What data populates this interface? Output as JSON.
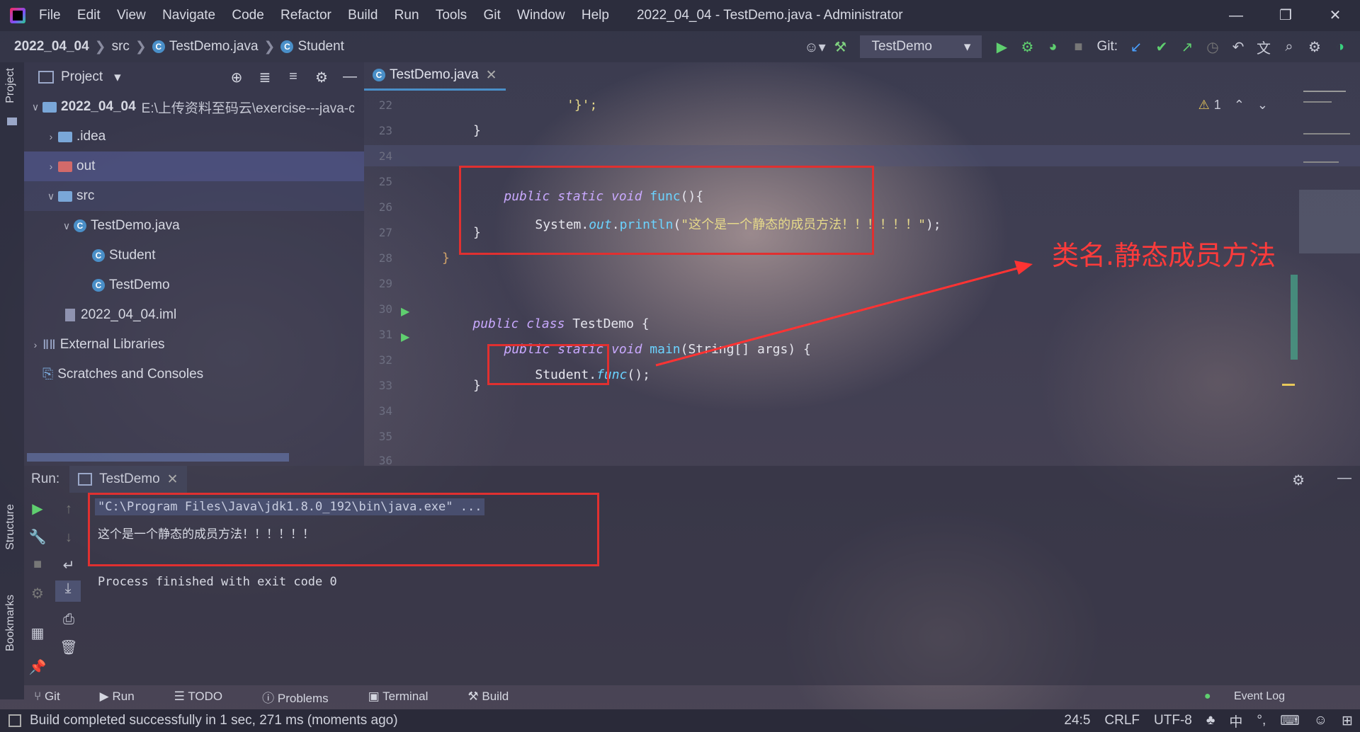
{
  "window": {
    "menu": [
      "File",
      "Edit",
      "View",
      "Navigate",
      "Code",
      "Refactor",
      "Build",
      "Run",
      "Tools",
      "Git",
      "Window",
      "Help"
    ],
    "title": "2022_04_04 - TestDemo.java - Administrator"
  },
  "breadcrumb": {
    "project": "2022_04_04",
    "folder": "src",
    "file": "TestDemo.java",
    "class": "Student"
  },
  "toolbar": {
    "run_config": "TestDemo",
    "git_label": "Git:"
  },
  "project_panel": {
    "title": "Project",
    "root": "2022_04_04",
    "root_path": "E:\\上传资料至码云\\exercise---java-cc",
    "items": {
      "idea": ".idea",
      "out": "out",
      "src": "src",
      "testdemo_java": "TestDemo.java",
      "student": "Student",
      "testdemo": "TestDemo",
      "iml": "2022_04_04.iml",
      "libs": "External Libraries",
      "scratches": "Scratches and Consoles"
    }
  },
  "editor": {
    "tab": "TestDemo.java",
    "warning_count": "1",
    "line_numbers": [
      "22",
      "23",
      "24",
      "25",
      "26",
      "27",
      "28",
      "29",
      "30",
      "31",
      "32",
      "33",
      "34",
      "35",
      "36"
    ],
    "code": {
      "l22": "'}';",
      "l23": "}",
      "l25_a": "public static void ",
      "l25_b": "func",
      "l25_c": "(){",
      "l26_a": "System.",
      "l26_b": "out",
      "l26_c": ".",
      "l26_d": "println",
      "l26_e": "(",
      "l26_f": "\"这个是一个静态的成员方法！！！！！！\"",
      "l26_g": ");",
      "l27": "}",
      "l28": "}",
      "l30_a": "public class ",
      "l30_b": "TestDemo {",
      "l31_a": "public static void ",
      "l31_b": "main",
      "l31_c": "(String[] args) {",
      "l32_a": "Student.",
      "l32_b": "func",
      "l32_c": "();",
      "l33": "}"
    },
    "annotation": "类名.静态成员方法"
  },
  "run_panel": {
    "label": "Run:",
    "tab": "TestDemo",
    "cmd": "\"C:\\Program Files\\Java\\jdk1.8.0_192\\bin\\java.exe\" ...",
    "output": "这个是一个静态的成员方法！！！！！！",
    "finish": "Process finished with exit code 0"
  },
  "side_labels": {
    "project": "Project",
    "structure": "Structure",
    "bookmarks": "Bookmarks"
  },
  "bottom_tabs": [
    "Git",
    "Run",
    "TODO",
    "Problems",
    "Terminal",
    "Build"
  ],
  "event_log": "Event Log",
  "status": {
    "message": "Build completed successfully in 1 sec, 271 ms (moments ago)",
    "position": "24:5",
    "line_sep": "CRLF",
    "encoding": "UTF-8",
    "ime": "中"
  }
}
